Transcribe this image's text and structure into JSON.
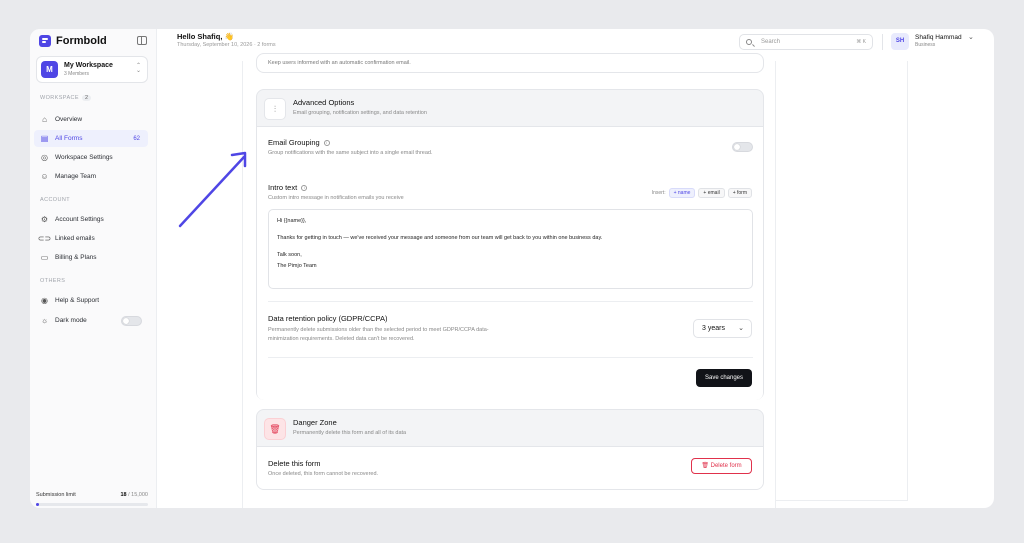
{
  "app": {
    "name": "Formbold"
  },
  "workspace": {
    "name": "My Workspace",
    "members": "3 Members",
    "avatar_letter": "M"
  },
  "sidebar": {
    "workspace_section": "WORKSPACE",
    "workspace_count": "2",
    "items": [
      {
        "label": "Overview",
        "icon": "home-icon"
      },
      {
        "label": "All Forms",
        "icon": "forms-icon",
        "badge": "62",
        "active": true
      },
      {
        "label": "Workspace Settings",
        "icon": "settings-icon"
      },
      {
        "label": "Manage Team",
        "icon": "team-icon"
      }
    ],
    "account_section": "ACCOUNT",
    "account_items": [
      {
        "label": "Account Settings",
        "icon": "gear-icon"
      },
      {
        "label": "Linked emails",
        "icon": "link-icon"
      },
      {
        "label": "Billing & Plans",
        "icon": "card-icon"
      }
    ],
    "others_section": "OTHERS",
    "other_items": [
      {
        "label": "Help & Support",
        "icon": "help-icon"
      },
      {
        "label": "Dark mode",
        "icon": "sun-icon"
      }
    ],
    "submission_limit_label": "Submission limit",
    "submission_used": "18",
    "submission_total": "/ 15,000",
    "submission_fraction": 0.0012
  },
  "header": {
    "greeting": "Hello Shafiq, 👋",
    "date": "Thursday, September 10, 2026 · 2 forms",
    "search_placeholder": "Search",
    "search_shortcut": "⌘ K",
    "user_initials": "SH",
    "user_name": "Shafiq Hammad",
    "user_plan": "Business"
  },
  "confirmation": {
    "text": "Keep users informed with an automatic confirmation email."
  },
  "advanced": {
    "title": "Advanced Options",
    "desc": "Email grouping, notification settings, and data retention",
    "grouping_title": "Email Grouping",
    "grouping_desc": "Group notifications with the same subject into a single email thread.",
    "intro_title": "Intro text",
    "intro_desc": "Custom intro message in notification emails you receive",
    "insert_label": "Insert:",
    "chips": [
      "+ name",
      "+ email",
      "+ form"
    ],
    "message": {
      "line1": "Hi {{name}},",
      "line2": "Thanks for getting in touch — we've received your message and someone from our team will get back to you within one business day.",
      "line3": "Talk soon,",
      "line4": "The Pimjo Team"
    },
    "retention_title": "Data retention policy (GDPR/CCPA)",
    "retention_desc1": "Permanently delete submissions older than the selected period to meet GDPR/CCPA data-",
    "retention_desc2": "minimization requirements. Deleted data can't be recovered.",
    "retention_value": "3 years",
    "save_label": "Save changes"
  },
  "danger": {
    "title": "Danger Zone",
    "desc": "Permanently delete this form and all of its data",
    "delete_title": "Delete this form",
    "delete_desc": "Once deleted, this form cannot be recovered.",
    "delete_label": "Delete form"
  },
  "colors": {
    "accent": "#4f46e5",
    "danger": "#e0314b",
    "dark": "#111318"
  }
}
